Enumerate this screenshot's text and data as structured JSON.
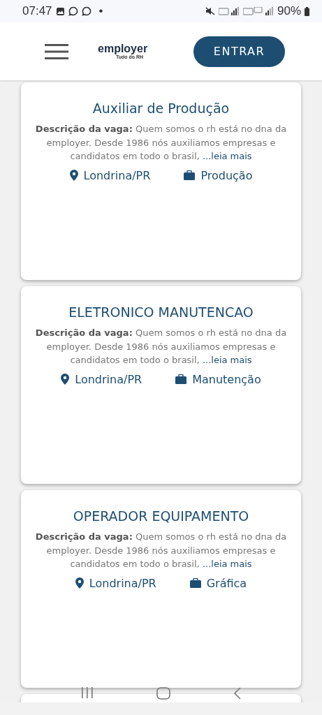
{
  "status_bar": {
    "time": "07:47",
    "dot": "•",
    "battery": "90%"
  },
  "header": {
    "logo": {
      "name": "employer",
      "tagline": "Tudo do RH"
    },
    "login_button": "ENTRAR"
  },
  "jobs": [
    {
      "title": "Auxiliar de Produção",
      "description": "**Descrição da vaga:** Quem somos o rh está no dna da employer. Desde 1986 nós auxiliamos empresas e candidatos em todo o brasil,",
      "read_more": "...leia mais",
      "location": "Londrina/PR",
      "category": "Produção"
    },
    {
      "title": "ELETRONICO MANUTENCAO",
      "description": "**Descrição da vaga:** Quem somos o rh está no dna da employer. Desde 1986 nós auxiliamos empresas e candidatos em todo o brasil,",
      "read_more": "...leia mais",
      "location": "Londrina/PR",
      "category": "Manutenção"
    },
    {
      "title": "OPERADOR EQUIPAMENTO",
      "description": "**Descrição da vaga:** Quem somos o rh está no dna da employer. Desde 1986 nós auxiliamos empresas e candidatos em todo o brasil,",
      "read_more": "...leia mais",
      "location": "Londrina/PR",
      "category": "Gráfica"
    }
  ]
}
